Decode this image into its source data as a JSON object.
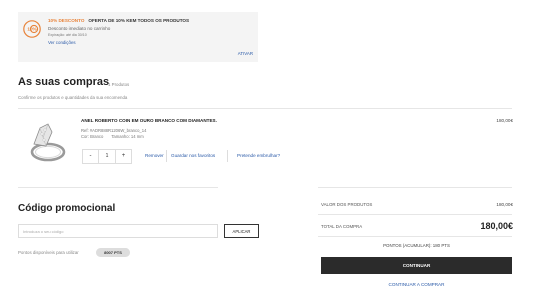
{
  "promo": {
    "badge_text": "10%",
    "tag": "10% DESCONTO",
    "offer": "OFERTA DE 10% KEM TODOS OS PRODUTOS",
    "line2": "Desconto imediato no carrinho",
    "line3": "Expiração: até dia 30/10",
    "link": "Ver condições",
    "activate": "ATIVAR",
    "accent_color": "#e8833a"
  },
  "cart": {
    "title": "As suas compras",
    "count": "1 Produtos",
    "subtitle": "Confirme os produtos e quantidades da sua encomenda"
  },
  "product": {
    "name": "ANEL ROBERTO COIN EM OURO BRANCO COM DIAMANTES.",
    "price": "180,00€",
    "ref": "Ref: #ADR888R1206W_branco_14",
    "color": "Cor: Branco",
    "size": "Tamanho: 14 mm",
    "quantity": "1",
    "minus": "-",
    "plus": "+",
    "actions": {
      "remove": "Remover",
      "save": "Guardar nos favoritos",
      "wrap": "Pretende embrulhar?"
    }
  },
  "promo_code": {
    "title": "Código promocional",
    "placeholder": "Introduza o seu código",
    "apply": "APLICAR",
    "points_label": "Pontos disponíveis para utilizar",
    "points_value": "8007 PTS"
  },
  "summary": {
    "products_label": "VALOR DOS PRODUTOS",
    "products_value": "180,00€",
    "total_label": "TOTAL DA COMPRA",
    "total_value": "180,00€",
    "points_accumulate": "PONTOS (ACUMULAR): 180 PTS",
    "continue": "CONTINUAR",
    "continue_shopping": "CONTINUAR A COMPRAR"
  },
  "colors": {
    "link": "#2a5aa8",
    "primary_button": "#2b2b2b",
    "promo_background": "#f4f4f4"
  }
}
